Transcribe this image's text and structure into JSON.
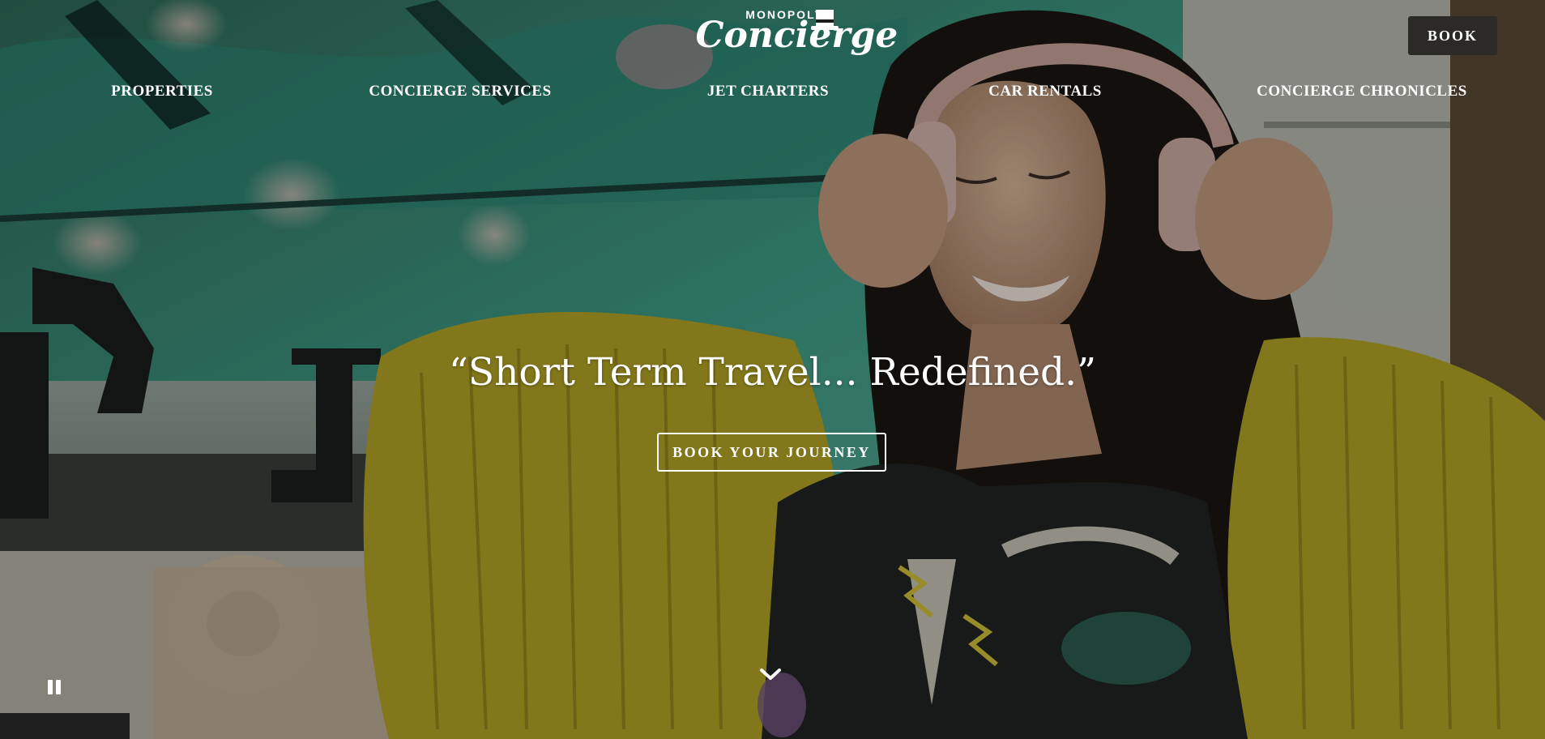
{
  "brand": {
    "logo_top": "MONOPOLY",
    "logo_main": "Concierge"
  },
  "header": {
    "book_label": "BOOK"
  },
  "nav": {
    "items": [
      {
        "label": "PROPERTIES"
      },
      {
        "label": "CONCIERGE SERVICES"
      },
      {
        "label": "JET CHARTERS"
      },
      {
        "label": "CAR RENTALS"
      },
      {
        "label": "CONCIERGE CHRONICLES"
      }
    ]
  },
  "hero": {
    "tagline": "“Short Term Travel... Redefined.”",
    "cta_label": "BOOK YOUR JOURNEY",
    "media": "background-video"
  },
  "controls": {
    "pause_icon": "pause-icon",
    "scroll_icon": "chevron-down-icon"
  },
  "colors": {
    "text": "#ffffff",
    "book_bg": "#2b2a26",
    "mural_teal": "#1f9b86",
    "fringe_yellow": "#b8a82a"
  }
}
